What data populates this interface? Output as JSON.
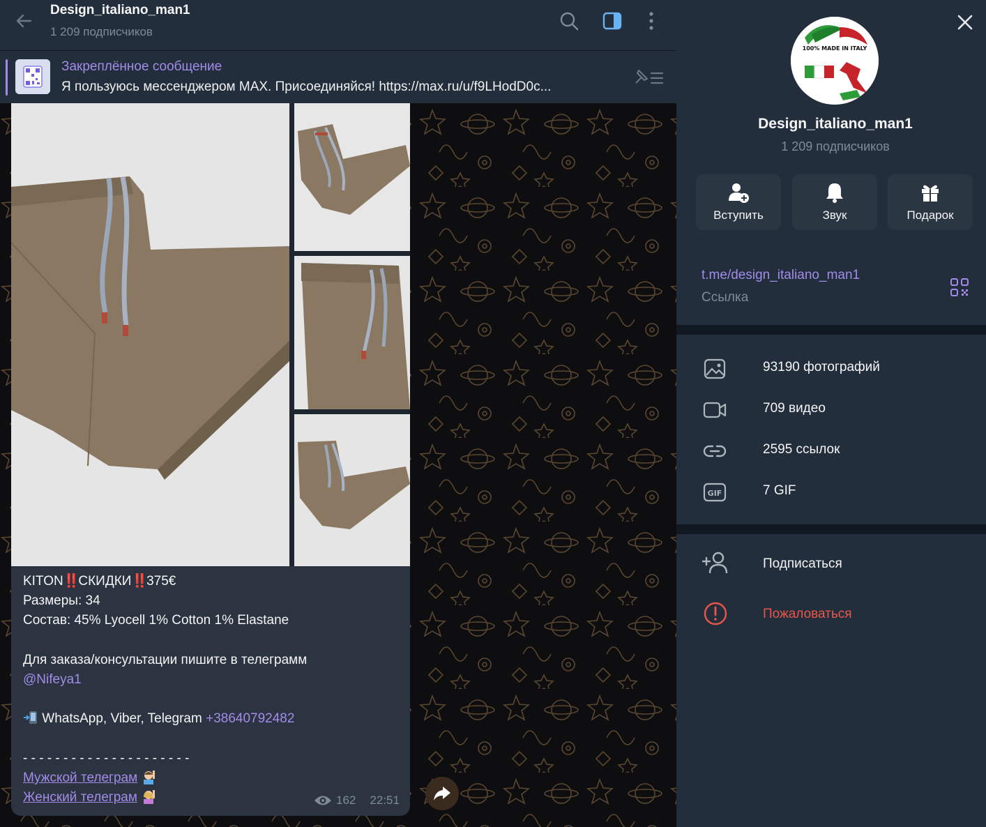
{
  "header": {
    "title": "Design_italiano_man1",
    "subscribers": "1 209 подписчиков"
  },
  "pinned": {
    "title": "Закреплённое сообщение",
    "text": "Я пользуюсь мессенджером MAX. Присоединяйся! https://max.ru/u/f9LHodD0c..."
  },
  "message": {
    "line1_a": "KITON",
    "line1_b": "‼️",
    "line1_c": "СКИДКИ",
    "line1_d": "‼️",
    "line1_e": "375€",
    "sizes": "Размеры: 34",
    "composition": "Состав: 45% Lyocell 1% Cotton 1% Elastane",
    "order": "Для заказа/консультации пишите в телеграмм",
    "mention": "@Nifeya1",
    "phone_prefix": "WhatsApp, Viber, Telegram ",
    "phone": "+38640792482",
    "divider": "- - - - - - - - - - - - - - - - - - - - -",
    "link_men": "Мужской телеграм",
    "link_women": "Женский телеграм",
    "views": "162",
    "time": "22:51"
  },
  "panel": {
    "title": "Design_italiano_man1",
    "subscribers": "1 209 подписчиков",
    "avatar_text": "100% MADE IN ITALY",
    "buttons": {
      "join": "Вступить",
      "sound": "Звук",
      "gift": "Подарок"
    },
    "link": {
      "url": "t.me/design_italiano_man1",
      "label": "Ссылка"
    },
    "media": [
      {
        "label": "93190 фотографий",
        "icon": "photo-icon"
      },
      {
        "label": "709 видео",
        "icon": "video-icon"
      },
      {
        "label": "2595 ссылок",
        "icon": "link-icon"
      },
      {
        "label": "7 GIF",
        "icon": "gif-icon"
      }
    ],
    "actions": {
      "subscribe": "Подписаться",
      "report": "Пожаловаться"
    }
  },
  "colors": {
    "accent": "#a28be9",
    "danger": "#e8564a",
    "panel_bg": "#232e3c",
    "bubble_bg": "#2b3440"
  }
}
